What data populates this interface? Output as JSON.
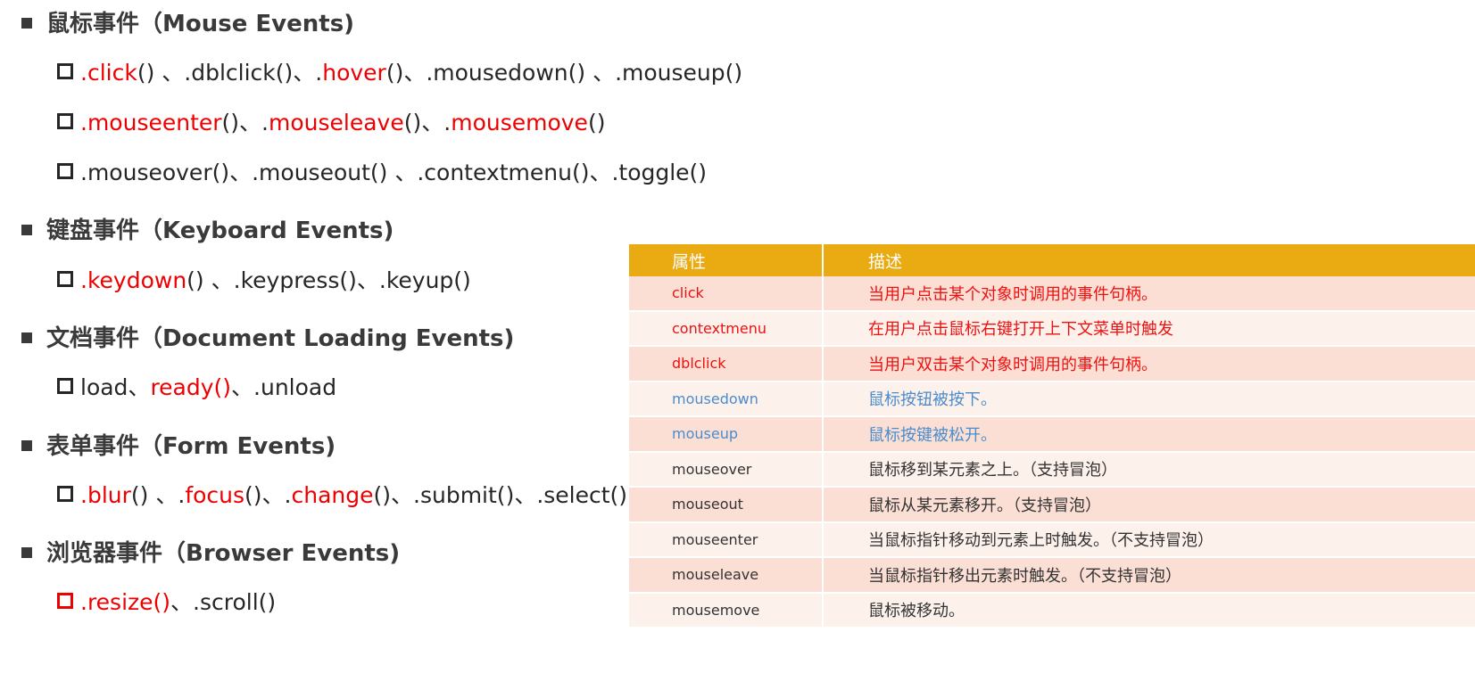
{
  "sections": {
    "mouse": "鼠标事件（Mouse Events)",
    "keyboard": "键盘事件（Keyboard Events)",
    "document": "文档事件（Document Loading Events)",
    "form": "表单事件（Form Events)",
    "browser": "浏览器事件（Browser Events)"
  },
  "mouse_line1": [
    ".",
    "click",
    "() 、.dblclick()、.",
    "hover",
    "()、.mousedown() 、.mouseup()"
  ],
  "mouse_line2": [
    ".",
    "mouseenter",
    "()、.",
    "mouseleave",
    "()、.",
    "mousemove",
    "()"
  ],
  "mouse_line3": ".mouseover()、.mouseout() 、.contextmenu()、.toggle()",
  "keyboard_line": [
    ".",
    "keydown",
    "() 、.keypress()、.keyup()"
  ],
  "document_line": [
    "load、",
    "ready()",
    "、.unload"
  ],
  "form_line": [
    ".",
    "blur",
    "() 、.",
    "focus",
    "()、.",
    "change",
    "()、.submit()、.select()"
  ],
  "browser_line": [
    ".resize()",
    "、.scroll()"
  ],
  "table": {
    "headers": [
      "属性",
      "描述"
    ],
    "rows": [
      {
        "attr": "click",
        "desc": "当用户点击某个对象时调用的事件句柄。",
        "color": "red"
      },
      {
        "attr": "contextmenu",
        "desc": "在用户点击鼠标右键打开上下文菜单时触发",
        "color": "red"
      },
      {
        "attr": "dblclick",
        "desc": "当用户双击某个对象时调用的事件句柄。",
        "color": "red"
      },
      {
        "attr": "mousedown",
        "desc": "鼠标按钮被按下。",
        "color": "blue"
      },
      {
        "attr": "mouseup",
        "desc": "鼠标按键被松开。",
        "color": "blue"
      },
      {
        "attr": "mouseover",
        "desc": "鼠标移到某元素之上。（支持冒泡）",
        "color": "dark"
      },
      {
        "attr": "mouseout",
        "desc": "鼠标从某元素移开。（支持冒泡）",
        "color": "dark"
      },
      {
        "attr": "mouseenter",
        "desc": "当鼠标指针移动到元素上时触发。（不支持冒泡）",
        "color": "dark"
      },
      {
        "attr": "mouseleave",
        "desc": "当鼠标指针移出元素时触发。（不支持冒泡）",
        "color": "dark"
      },
      {
        "attr": "mousemove",
        "desc": "鼠标被移动。",
        "color": "dark"
      }
    ]
  },
  "colors": {
    "accent_red": "#ee0000",
    "header_bg": "#eaaa12",
    "row_odd": "#fbdfd4",
    "row_even": "#fdf1ec",
    "blue_text": "#4a8ccc"
  }
}
